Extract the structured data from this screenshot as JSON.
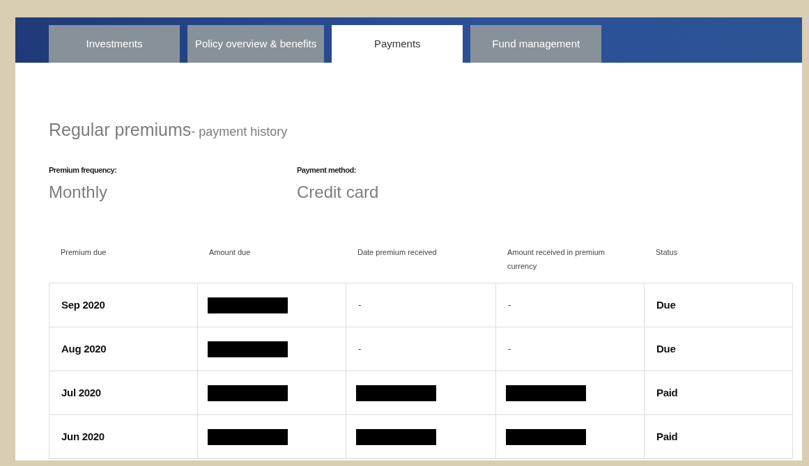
{
  "tabs": [
    {
      "label": "Investments",
      "selected": false
    },
    {
      "label": "Policy overview & benefits",
      "selected": false
    },
    {
      "label": "Payments",
      "selected": true
    },
    {
      "label": "Fund management",
      "selected": false
    }
  ],
  "section": {
    "title": "Regular premiums",
    "subtitle": "- payment history"
  },
  "summary": [
    {
      "label": "Premium frequency:",
      "value": "Monthly"
    },
    {
      "label": "Payment method:",
      "value": "Credit card"
    }
  ],
  "table": {
    "columns": [
      "Premium due",
      "Amount due",
      "Date premium received",
      "Amount received in premium currency",
      "Status"
    ],
    "rows": [
      {
        "cells": [
          {
            "kind": "bold",
            "text": "Sep 2020"
          },
          {
            "kind": "redacted"
          },
          {
            "kind": "text",
            "text": "-"
          },
          {
            "kind": "text",
            "text": "-"
          },
          {
            "kind": "bold",
            "text": "Due"
          }
        ]
      },
      {
        "cells": [
          {
            "kind": "bold",
            "text": "Aug 2020"
          },
          {
            "kind": "redacted"
          },
          {
            "kind": "text",
            "text": "-"
          },
          {
            "kind": "text",
            "text": "-"
          },
          {
            "kind": "bold",
            "text": "Due"
          }
        ]
      },
      {
        "cells": [
          {
            "kind": "bold",
            "text": "Jul 2020"
          },
          {
            "kind": "redacted"
          },
          {
            "kind": "redacted"
          },
          {
            "kind": "redacted"
          },
          {
            "kind": "bold",
            "text": "Paid"
          }
        ]
      },
      {
        "cells": [
          {
            "kind": "bold",
            "text": "Jun 2020"
          },
          {
            "kind": "redacted"
          },
          {
            "kind": "redacted"
          },
          {
            "kind": "redacted"
          },
          {
            "kind": "bold",
            "text": "Paid"
          }
        ]
      }
    ]
  }
}
